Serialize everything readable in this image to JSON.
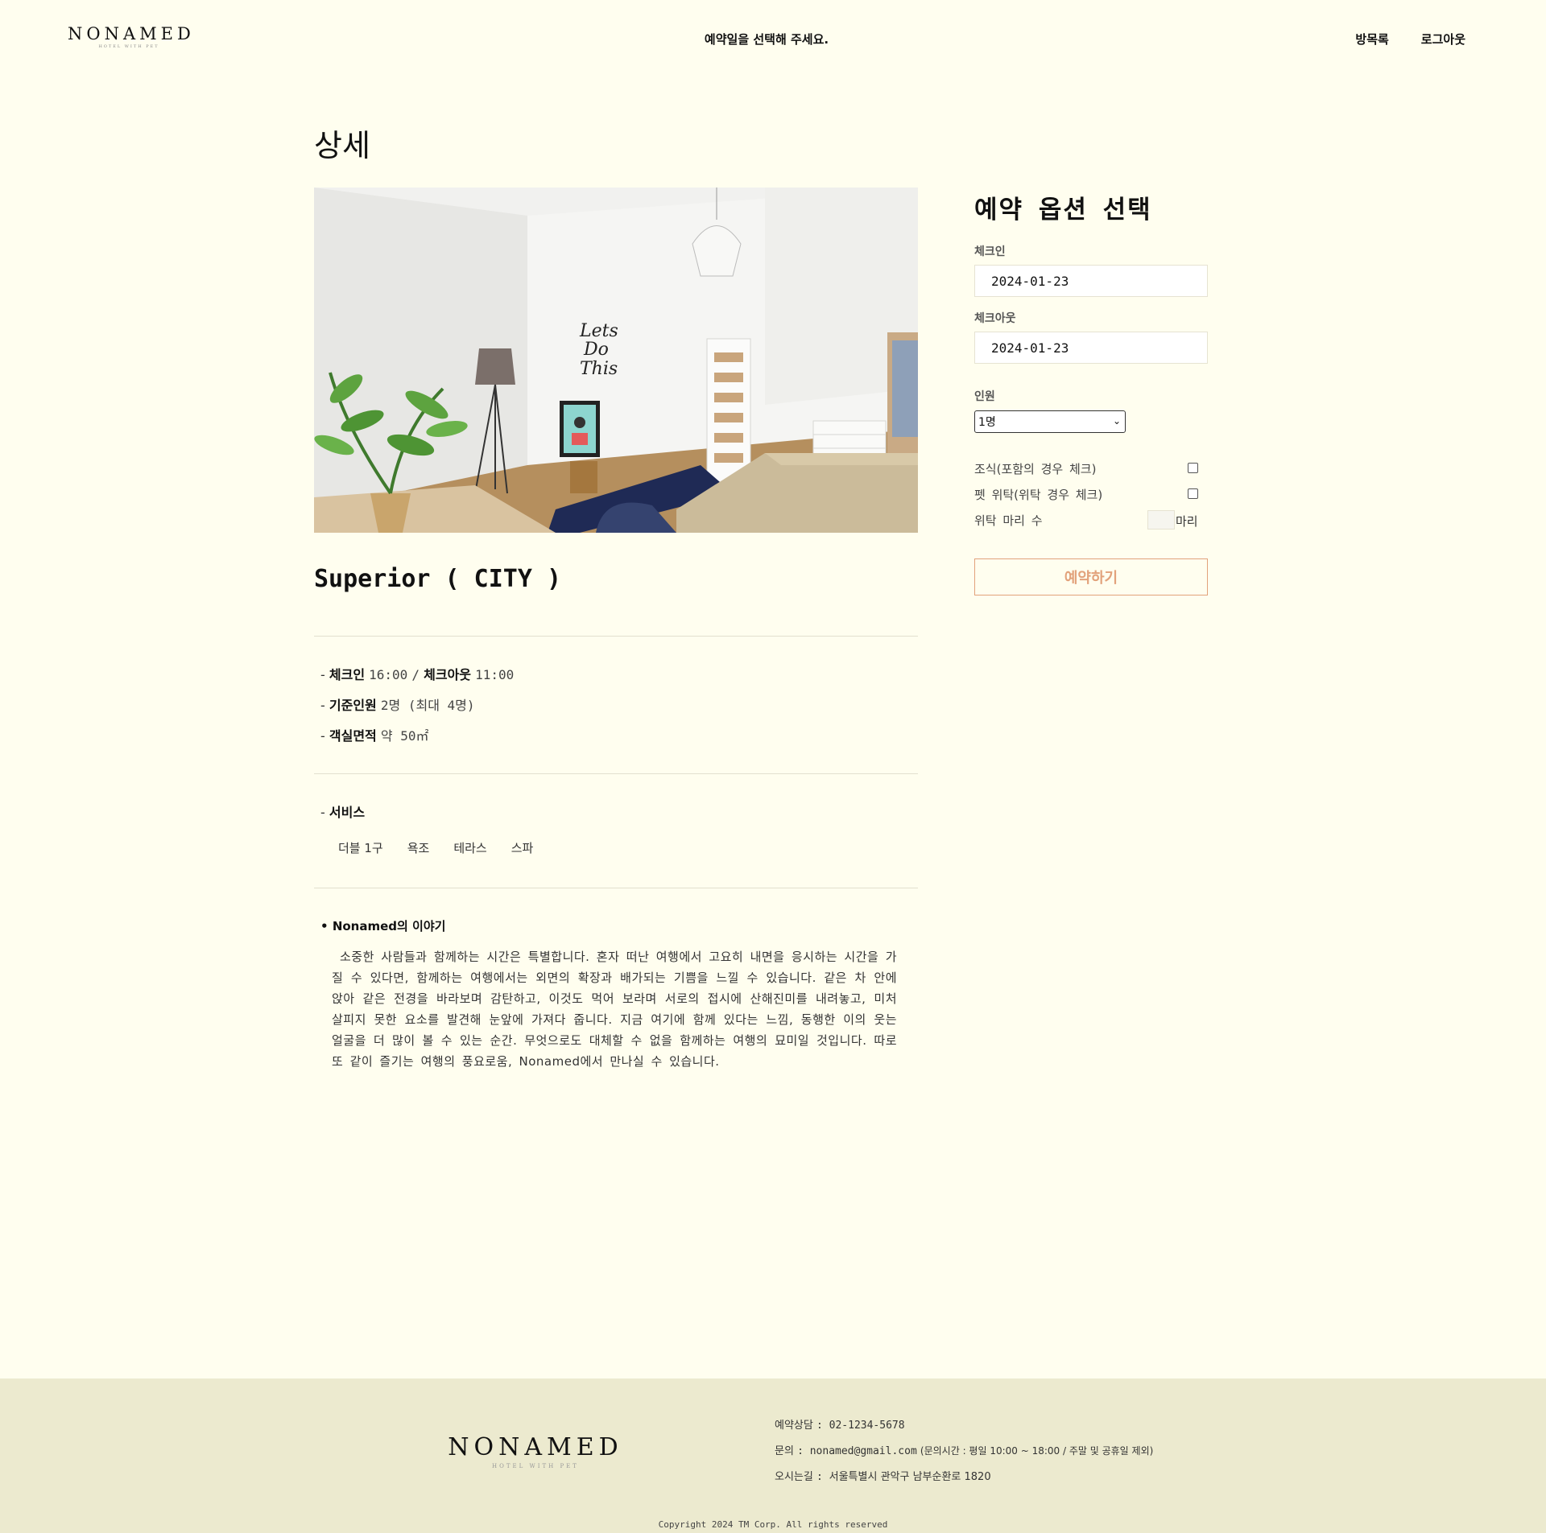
{
  "header": {
    "logo_brand": "NONAMED",
    "logo_sub": "HOTEL WITH PET",
    "message": "예약일을 선택해 주세요.",
    "nav": {
      "rooms": "방목록",
      "logout": "로그아웃"
    }
  },
  "main": {
    "title": "상세",
    "room_name": "Superior ( CITY )",
    "info": {
      "checkin_label": "체크인",
      "checkin_time": "16:00",
      "separator": "/",
      "checkout_label": "체크아웃",
      "checkout_time": "11:00",
      "capacity_label": "기준인원",
      "capacity_value": "2명 (최대 4명)",
      "area_label": "객실면적",
      "area_value": "약 50㎡"
    },
    "services_label": "서비스",
    "services": [
      "더블 1구",
      "욕조",
      "테라스",
      "스파"
    ],
    "story_title": "Nonamed의 이야기",
    "story_text": "소중한 사람들과 함께하는 시간은 특별합니다. 혼자 떠난 여행에서 고요히 내면을 응시하는 시간을 가질 수 있다면, 함께하는 여행에서는 외면의 확장과 배가되는 기쁨을 느낄 수 있습니다. 같은 차 안에 앉아 같은 전경을 바라보며 감탄하고, 이것도 먹어 보라며 서로의 접시에 산해진미를 내려놓고, 미처 살피지 못한 요소를 발견해 눈앞에 가져다 줍니다. 지금 여기에 함께 있다는 느낌, 동행한 이의 웃는 얼굴을 더 많이 볼 수 있는 순간. 무엇으로도 대체할 수 없을 함께하는 여행의 묘미일 것입니다. 따로 또 같이 즐기는 여행의 풍요로움, Nonamed에서 만나실 수 있습니다."
  },
  "reservation": {
    "title": "예약 옵션 선택",
    "checkin_label": "체크인",
    "checkin_value": "2024-01-23",
    "checkout_label": "체크아웃",
    "checkout_value": "2024-01-23",
    "guests_label": "인원",
    "guests_selected": "1명",
    "breakfast_label": "조식(포함의 경우 체크)",
    "pet_label": "펫 위탁(위탁 경우 체크)",
    "pet_count_label": "위탁 마리 수",
    "pet_count_unit": "마리",
    "reserve_button": "예약하기"
  },
  "footer": {
    "logo_brand": "NONAMED",
    "logo_sub": "HOTEL WITH PET",
    "phone_label": "예약상담",
    "phone_value": "02-1234-5678",
    "email_label": "문의",
    "email_value": "nonamed@gmail.com",
    "hours": "(문의시간 : 평일 10:00 ~ 18:00 / 주말 및 공휴일 제외)",
    "address_label": "오시는길",
    "address_value": "서울특별시 관악구 남부순환로 1820",
    "copyright": "Copyright 2024 TM Corp. All rights reserved"
  },
  "colors": {
    "background": "#fffeef",
    "footer": "#eceacf",
    "accent": "#e2a27b"
  }
}
